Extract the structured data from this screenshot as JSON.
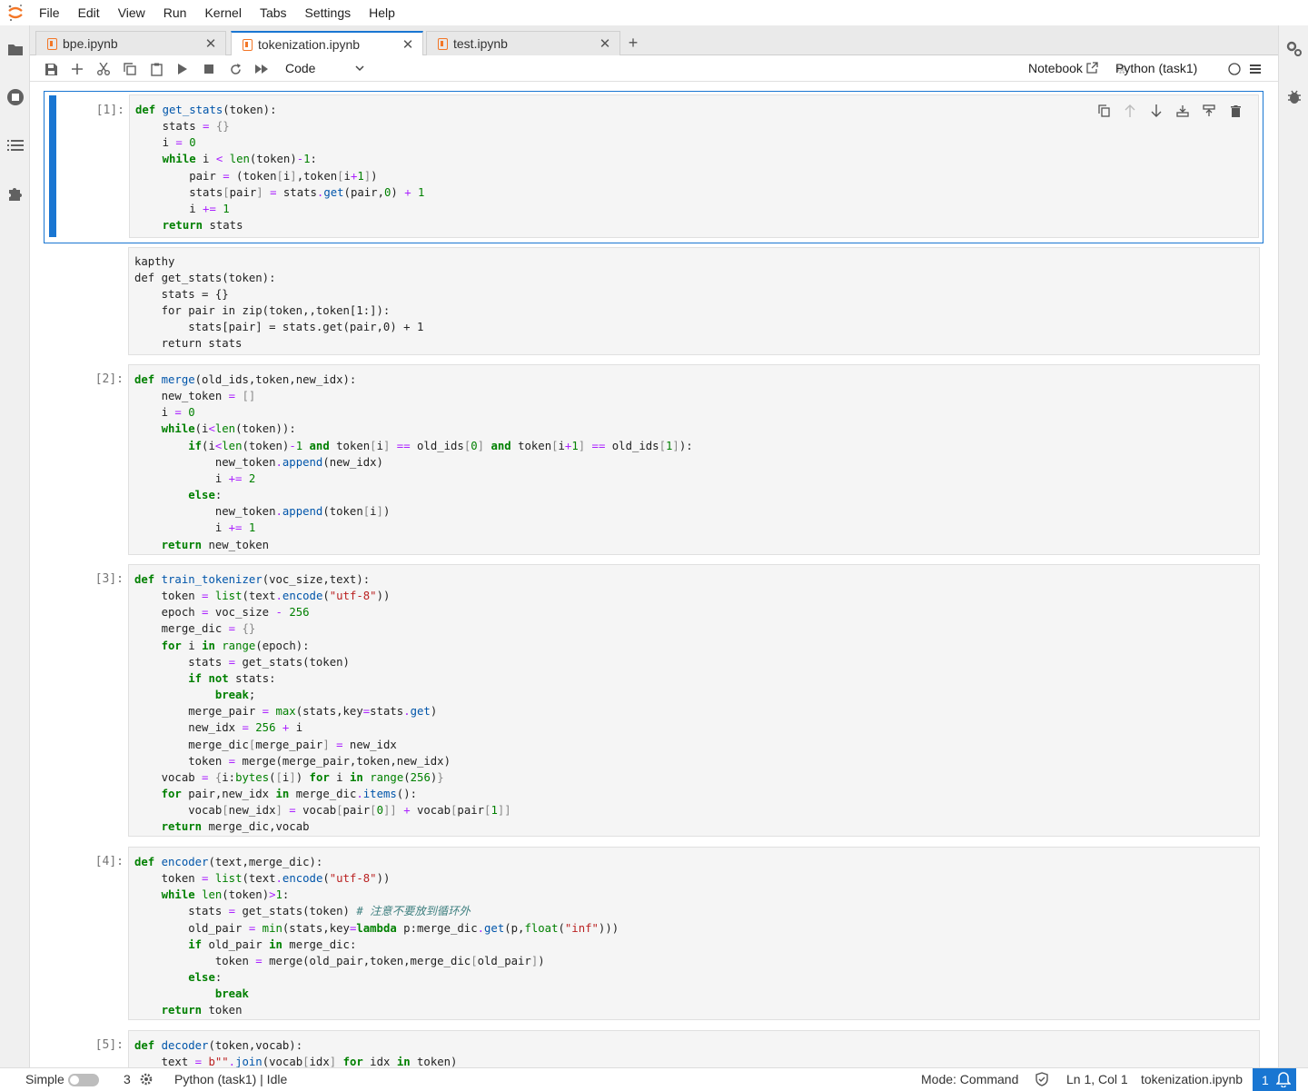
{
  "menubar": {
    "items": [
      "File",
      "Edit",
      "View",
      "Run",
      "Kernel",
      "Tabs",
      "Settings",
      "Help"
    ]
  },
  "sidebar_left": {
    "icons": [
      "folder-icon",
      "running-icon",
      "toc-icon",
      "extension-icon"
    ]
  },
  "sidebar_right": {
    "icons": [
      "property-inspector-icon",
      "debugger-icon"
    ]
  },
  "tabs": [
    {
      "label": "bpe.ipynb",
      "active": false
    },
    {
      "label": "tokenization.ipynb",
      "active": true
    },
    {
      "label": "test.ipynb",
      "active": false
    }
  ],
  "toolbar": {
    "cell_type": "Code",
    "notebook_label": "Notebook",
    "kernel_name": "Python (task1)"
  },
  "cells": [
    {
      "prompt": "[1]:",
      "type": "code",
      "selected": true,
      "source": "def get_stats(token):\n    stats = {}\n    i = 0\n    while i < len(token)-1:\n        pair = (token[i],token[i+1])\n        stats[pair] = stats.get(pair,0) + 1\n        i += 1\n    return stats"
    },
    {
      "prompt": "",
      "type": "markdown",
      "source": "kapthy\ndef get_stats(token):\n    stats = {}\n    for pair in zip(token,,token[1:]):\n        stats[pair] = stats.get(pair,0) + 1\n    return stats"
    },
    {
      "prompt": "[2]:",
      "type": "code",
      "source": "def merge(old_ids,token,new_idx):\n    new_token = []\n    i = 0\n    while(i<len(token)):\n        if(i<len(token)-1 and token[i] == old_ids[0] and token[i+1] == old_ids[1]):\n            new_token.append(new_idx)\n            i += 2\n        else:\n            new_token.append(token[i])\n            i += 1\n    return new_token"
    },
    {
      "prompt": "[3]:",
      "type": "code",
      "source": "def train_tokenizer(voc_size,text):\n    token = list(text.encode(\"utf-8\"))\n    epoch = voc_size - 256\n    merge_dic = {}\n    for i in range(epoch):\n        stats = get_stats(token)\n        if not stats:\n            break;\n        merge_pair = max(stats,key=stats.get)\n        new_idx = 256 + i\n        merge_dic[merge_pair] = new_idx\n        token = merge(merge_pair,token,new_idx)\n    vocab = {i:bytes([i]) for i in range(256)}\n    for pair,new_idx in merge_dic.items():\n        vocab[new_idx] = vocab[pair[0]] + vocab[pair[1]]\n    return merge_dic,vocab"
    },
    {
      "prompt": "[4]:",
      "type": "code",
      "source": "def encoder(text,merge_dic):\n    token = list(text.encode(\"utf-8\"))\n    while len(token)>1:\n        stats = get_stats(token) # 注意不要放到循环外\n        old_pair = min(stats,key=lambda p:merge_dic.get(p,float(\"inf\")))\n        if old_pair in merge_dic:\n            token = merge(old_pair,token,merge_dic[old_pair])\n        else:\n            break\n    return token"
    },
    {
      "prompt": "[5]:",
      "type": "code",
      "source": "def decoder(token,vocab):\n    text = b\"\".join(vocab[idx] for idx in token)"
    }
  ],
  "statusbar": {
    "mode_simple": "Simple",
    "kernel_count": "3",
    "kernel_status": "Python (task1) | Idle",
    "mode": "Mode: Command",
    "position": "Ln 1, Col 1",
    "filename": "tokenization.ipynb",
    "notifications": "1"
  }
}
